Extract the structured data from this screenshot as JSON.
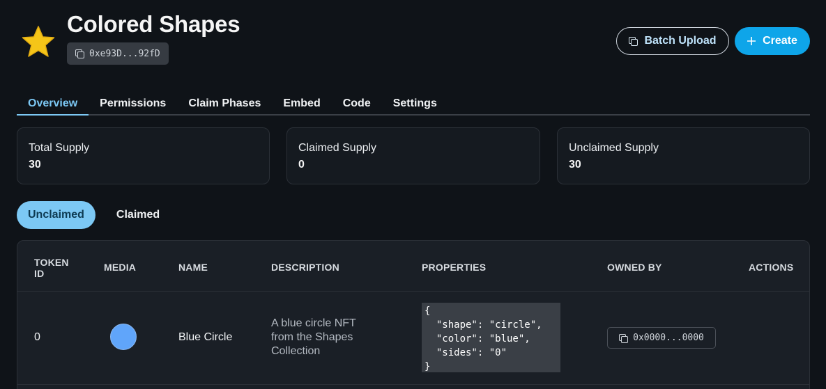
{
  "header": {
    "title": "Colored Shapes",
    "address": "0xe93D...92fD",
    "batch_upload_label": "Batch Upload",
    "create_label": "Create",
    "icons": {
      "logo": "star-icon",
      "copy": "copy-icon",
      "plus": "plus-icon"
    }
  },
  "tabs": [
    {
      "label": "Overview",
      "active": true
    },
    {
      "label": "Permissions"
    },
    {
      "label": "Claim Phases"
    },
    {
      "label": "Embed"
    },
    {
      "label": "Code"
    },
    {
      "label": "Settings"
    }
  ],
  "stats": [
    {
      "label": "Total Supply",
      "value": "30"
    },
    {
      "label": "Claimed Supply",
      "value": "0"
    },
    {
      "label": "Unclaimed Supply",
      "value": "30"
    }
  ],
  "filters": {
    "unclaimed": "Unclaimed",
    "claimed": "Claimed"
  },
  "table": {
    "headers": {
      "token_id_1": "Token",
      "token_id_2": "ID",
      "media": "Media",
      "name": "Name",
      "description": "Description",
      "properties": "Properties",
      "owned_by": "Owned By",
      "actions": "Actions"
    },
    "rows": [
      {
        "token_id": "0",
        "media_color": "#60a5fa",
        "name": "Blue Circle",
        "description_lines": [
          "A blue circle NFT",
          "from the Shapes",
          "Collection"
        ],
        "properties_lines": [
          "{",
          "  \"shape\": \"circle\",",
          "  \"color\": \"blue\",",
          "  \"sides\": \"0\"",
          "}"
        ],
        "owned_by": "0x0000...0000"
      }
    ]
  },
  "colors": {
    "accent": "#7cc8f4",
    "create_button": "#0ea5e9",
    "background": "#0f1318"
  }
}
